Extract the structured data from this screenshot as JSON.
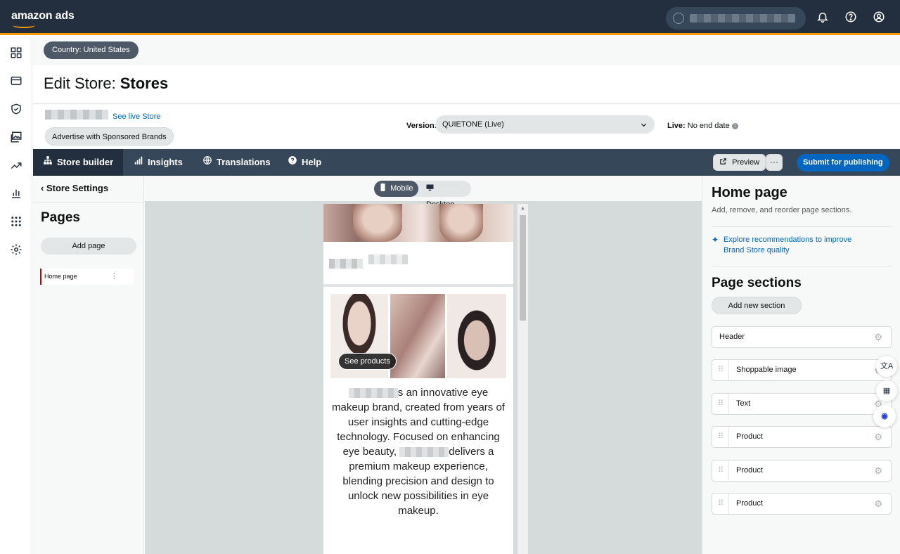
{
  "topbar": {
    "logo_text": "amazon ads",
    "icons": [
      "globe-icon",
      "bell-icon",
      "help-icon",
      "account-icon"
    ]
  },
  "sidenav": {
    "icons": [
      "dashboard-icon",
      "wallet-icon",
      "shield-icon",
      "gallery-icon",
      "trend-icon",
      "bar-chart-icon",
      "apps-icon",
      "settings-icon"
    ]
  },
  "country": {
    "label": "Country: United States"
  },
  "title": {
    "prefix": "Edit Store:",
    "name": "Stores"
  },
  "info": {
    "live_link": "See live Store",
    "sponsored_button": "Advertise with Sponsored Brands",
    "version_label": "Version:",
    "version_value": "QUIETONE (Live)",
    "live_label": "Live:",
    "live_value": "No end date"
  },
  "tabs": [
    {
      "label": "Store builder",
      "icon": "sitemap-icon",
      "active": true
    },
    {
      "label": "Insights",
      "icon": "signal-icon",
      "active": false
    },
    {
      "label": "Translations",
      "icon": "globe-icon",
      "active": false
    },
    {
      "label": "Help",
      "icon": "help-icon",
      "active": false
    }
  ],
  "toolbar": {
    "preview": "Preview",
    "more": "···",
    "submit": "Submit for publishing"
  },
  "left_panel": {
    "store_settings": "Store Settings",
    "pages_title": "Pages",
    "add_page": "Add page",
    "pages": [
      {
        "label": "Home page",
        "selected": true
      }
    ]
  },
  "canvas": {
    "view_mobile": "Mobile",
    "view_desktop": "Desktop",
    "see_products": "See products",
    "store_text": {
      "part1": "s an innovative eye makeup brand, created from years of user insights and cutting-edge technology. Focused on enhancing eye beauty,",
      "part2": "delivers a premium makeup experience, blending precision and design to unlock new possibilities in eye makeup."
    }
  },
  "right_panel": {
    "title": "Home page",
    "subtitle": "Add, remove, and reorder page sections.",
    "recommendation": "Explore recommendations to improve Brand Store quality",
    "sections_title": "Page sections",
    "add_section": "Add new section",
    "sections": [
      "Header",
      "Shoppable image",
      "Text",
      "Product",
      "Product",
      "Product"
    ]
  },
  "colors": {
    "topbar": "#232f3e",
    "accent": "#ff9900",
    "tabbar": "#37475a",
    "link": "#0066c0",
    "active_page_marker": "#c40000"
  }
}
